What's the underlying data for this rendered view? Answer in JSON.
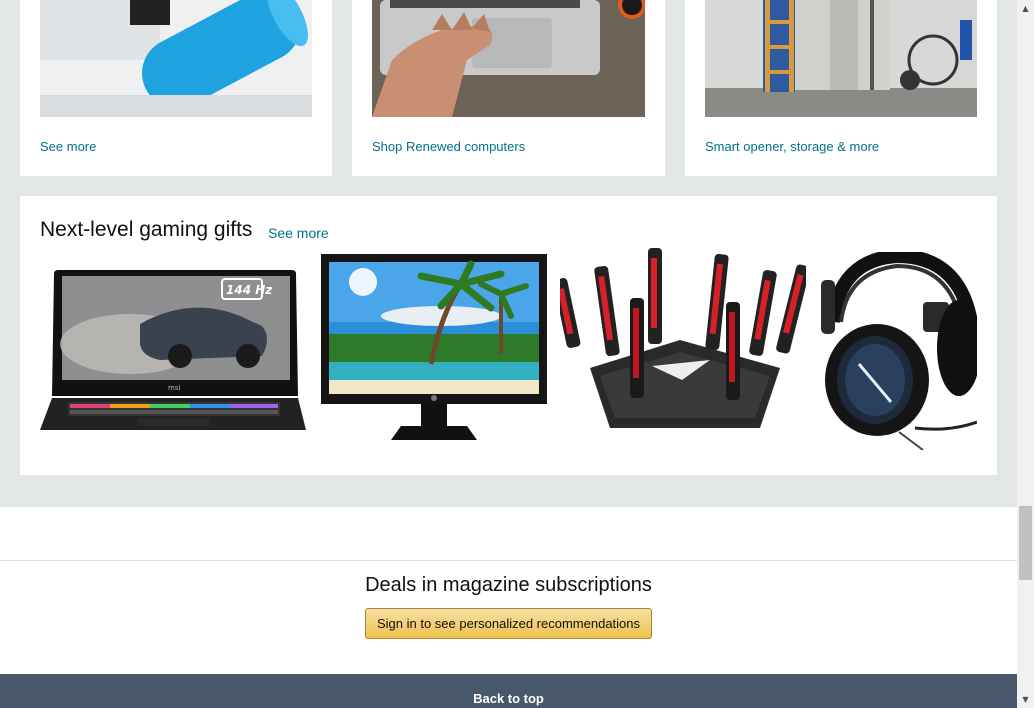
{
  "top_cards": [
    {
      "link": "See more"
    },
    {
      "link": "Shop Renewed computers"
    },
    {
      "link": "Smart opener, storage & more"
    }
  ],
  "gaming": {
    "title": "Next-level gaming gifts",
    "see_more": "See more",
    "products": [
      {
        "name": "gaming-laptop",
        "badge": "144 Hz"
      },
      {
        "name": "hp-monitor"
      },
      {
        "name": "wifi-router"
      },
      {
        "name": "gaming-headset"
      }
    ]
  },
  "recs": {
    "heading": "Deals in magazine subscriptions",
    "button": "Sign in to see personalized recommendations"
  },
  "footer": {
    "back_to_top": "Back to top"
  },
  "colors": {
    "link": "#007185",
    "button": "#f0c14b",
    "footer_bg": "#485769",
    "page_bg": "#e3e6e6"
  }
}
